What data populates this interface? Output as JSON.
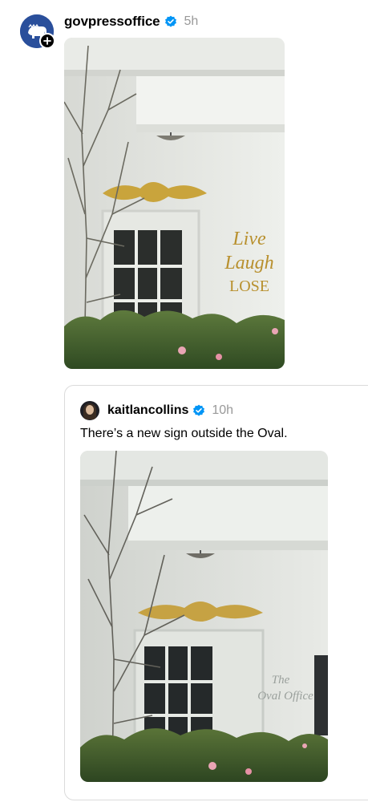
{
  "post": {
    "username": "govpressoffice",
    "time": "5h",
    "sign_lines": [
      "Live",
      "Laugh",
      "LOSE"
    ]
  },
  "quote": {
    "username": "kaitlancollins",
    "time": "10h",
    "text": "There’s a new sign outside the Oval.",
    "sign_lines": [
      "The",
      "Oval Office"
    ]
  },
  "icons": {
    "verified": "verified-badge-icon",
    "follow": "plus-icon"
  },
  "colors": {
    "verified": "#0095f6",
    "sign_gold": "#b8902e",
    "secondary_text": "#999999"
  }
}
